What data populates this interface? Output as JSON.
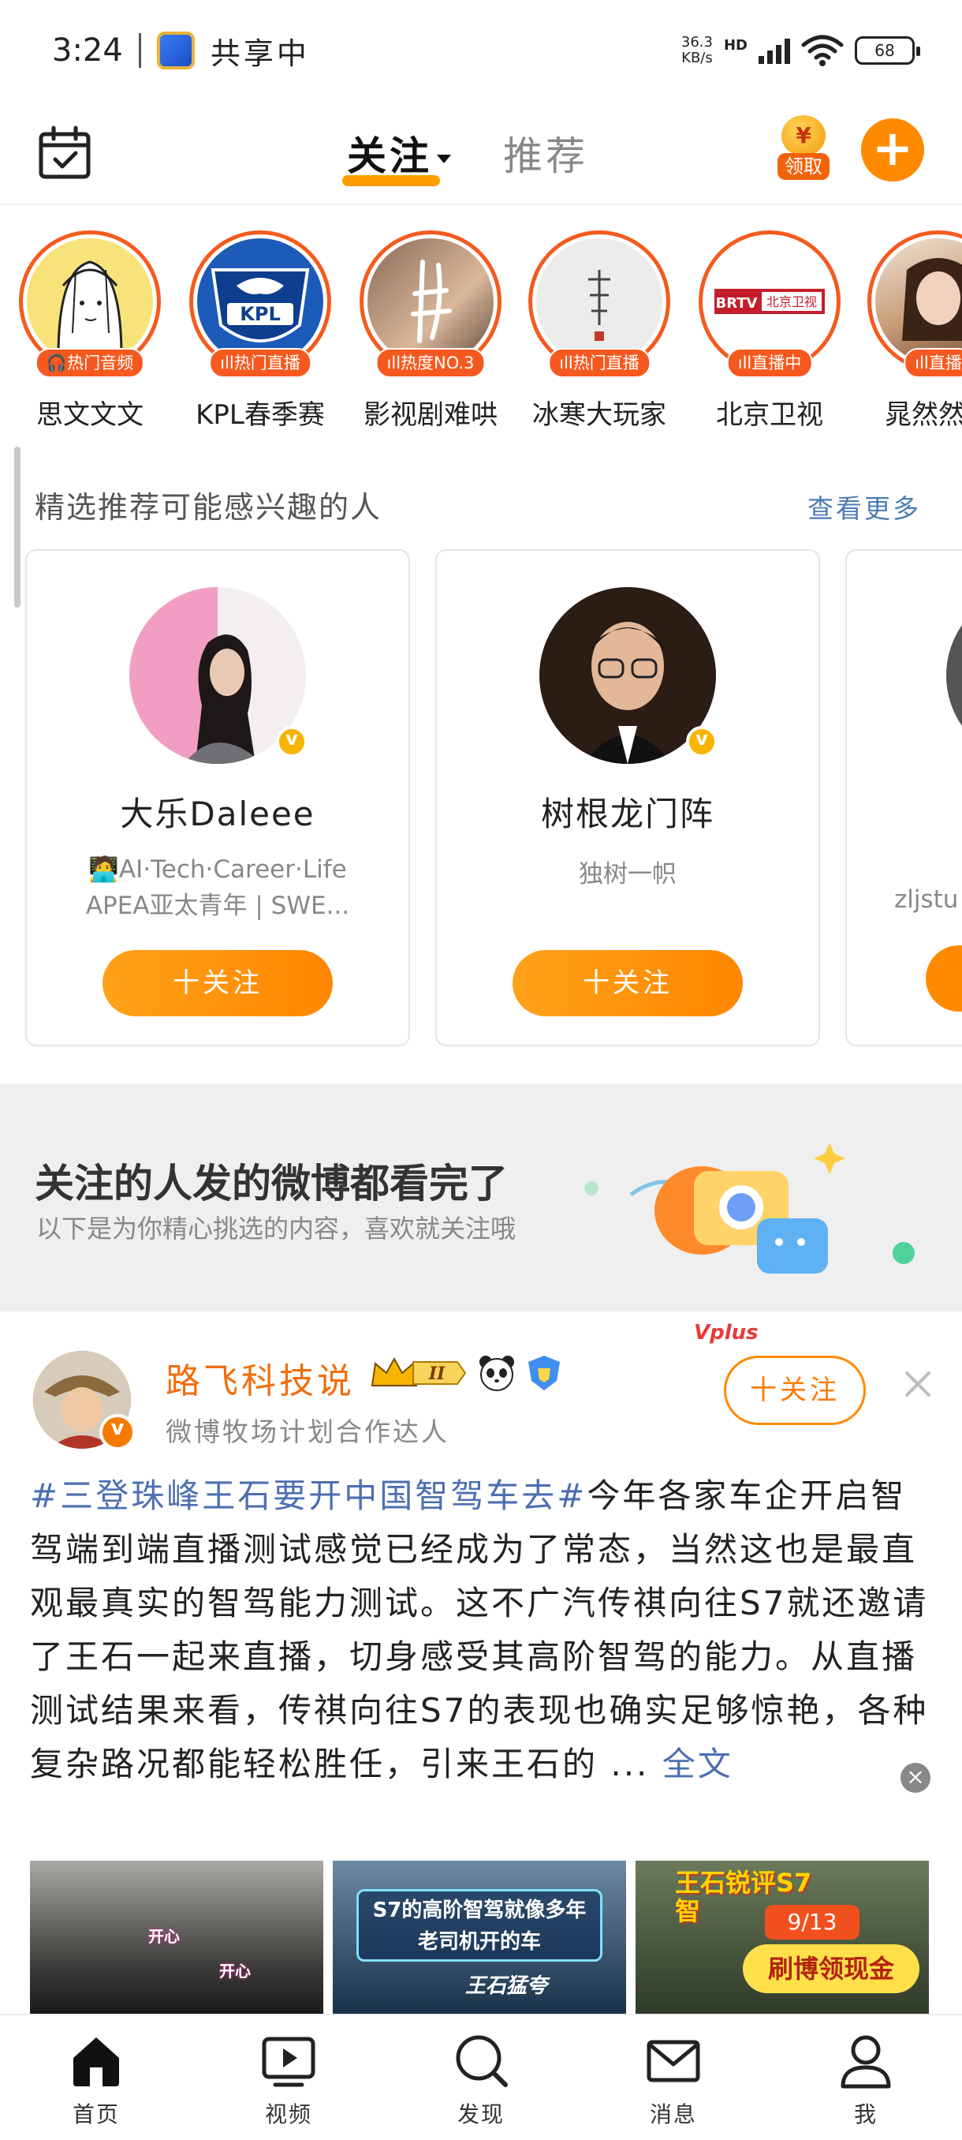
{
  "status_bar": {
    "time": "3:24",
    "share_text": "共享中",
    "speed_value": "36.3",
    "speed_unit": "KB/s",
    "network_label": "HD",
    "battery": "68"
  },
  "top_nav": {
    "tab_follow": "关注",
    "tab_recommend": "推荐",
    "coin_symbol": "¥",
    "coin_label": "领取",
    "plus": "+"
  },
  "stories": [
    {
      "name": "思文文文",
      "badge": "热门音频",
      "badge_icon": "headphones-icon"
    },
    {
      "name": "KPL春季赛",
      "badge": "热门直播",
      "badge_icon": "live-bars-icon"
    },
    {
      "name": "影视剧难哄",
      "badge": "热度NO.3",
      "badge_icon": "live-bars-icon"
    },
    {
      "name": "冰寒大玩家",
      "badge": "热门直播",
      "badge_icon": "live-bars-icon"
    },
    {
      "name": "北京卫视",
      "badge": "直播中",
      "badge_icon": "live-bars-icon"
    },
    {
      "name": "晁然然然",
      "badge": "直播",
      "badge_icon": "live-bars-icon"
    }
  ],
  "story_logo_texts": {
    "kpl": "KPL",
    "brtv": "BRTV",
    "beijing": "北京卫视"
  },
  "suggestions": {
    "title": "精选推荐可能感兴趣的人",
    "more_label": "查看更多",
    "cards": [
      {
        "name": "大乐Daleee",
        "desc_line1": "🧑‍💻AI·Tech·Career·Life",
        "desc_line2": "APEA亚太青年 | SWE...",
        "follow_label": "十关注"
      },
      {
        "name": "树根龙门阵",
        "desc_line1": "独树一帜",
        "desc_line2": "",
        "follow_label": "十关注"
      },
      {
        "name": "",
        "desc_line1": "zljstu",
        "desc_line2": "",
        "follow_label": ""
      }
    ]
  },
  "banner": {
    "title": "关注的人发的微博都看完了",
    "subtitle": "以下是为你精心挑选的内容，喜欢就关注哦"
  },
  "post": {
    "author": "路飞科技说",
    "level": "II",
    "source": "微博牧场计划合作达人",
    "follow_label": "十关注",
    "vplus_label": "Vplus",
    "topic": "#三登珠峰王石要开中国智驾车去#",
    "body": "今年各家车企开启智驾端到端直播测试感觉已经成为了常态，当然这也是最直观最真实的智驾能力测试。这不广汽传祺向往S7就还邀请了王石一起来直播，切身感受其高阶智驾的能力。从直播测试结果来看，传祺向往S7的表现也确实足够惊艳，各种复杂路况都能轻松胜任，引来王石的 ...",
    "more_label": "全文",
    "thumbs": [
      {
        "caption": "开心"
      },
      {
        "caption": "S7的高阶智驾就像多年老司机开的车",
        "sub": "王石猛夸"
      },
      {
        "caption": "王石锐评S7智",
        "date": "9/13",
        "tag": "刷博领现金"
      }
    ]
  },
  "bottom_nav": [
    {
      "label": "首页",
      "icon": "home-icon"
    },
    {
      "label": "视频",
      "icon": "video-icon"
    },
    {
      "label": "发现",
      "icon": "search-icon"
    },
    {
      "label": "消息",
      "icon": "mail-icon"
    },
    {
      "label": "我",
      "icon": "profile-icon"
    }
  ]
}
